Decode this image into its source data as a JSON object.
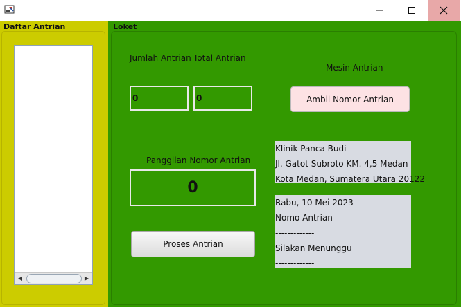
{
  "window": {
    "icon": "java-app-icon",
    "controls": [
      "minimize-icon",
      "maximize-icon",
      "close-icon"
    ]
  },
  "left_panel": {
    "title": "Daftar Antrian",
    "list_value": ""
  },
  "right_panel": {
    "title": "Loket",
    "jumlah_label": "Jumlah Antrian",
    "total_label": "Total Antrian",
    "jumlah_value": "0",
    "total_value": "0",
    "mesin_label": "Mesin Antrian",
    "ambil_button": "Ambil Nomor Antrian",
    "panggilan_label": "Panggilan Nomor Antrian",
    "panggilan_value": "0",
    "proses_button": "Proses Antrian"
  },
  "clinic_info": [
    "Klinik Panca Budi",
    "Jl. Gatot Subroto KM. 4,5 Medan",
    "Kota Medan, Sumatera Utara 20122"
  ],
  "ticket_info": [
    "Rabu, 10 Mei 2023",
    "Nomo Antrian",
    "-------------",
    "Silakan Menunggu",
    "-------------"
  ],
  "colors": {
    "left_panel_bg": "#cccc00",
    "right_panel_bg": "#339900",
    "ambil_button_bg": "#fde2e4",
    "info_box_bg": "#d8dbe2"
  }
}
